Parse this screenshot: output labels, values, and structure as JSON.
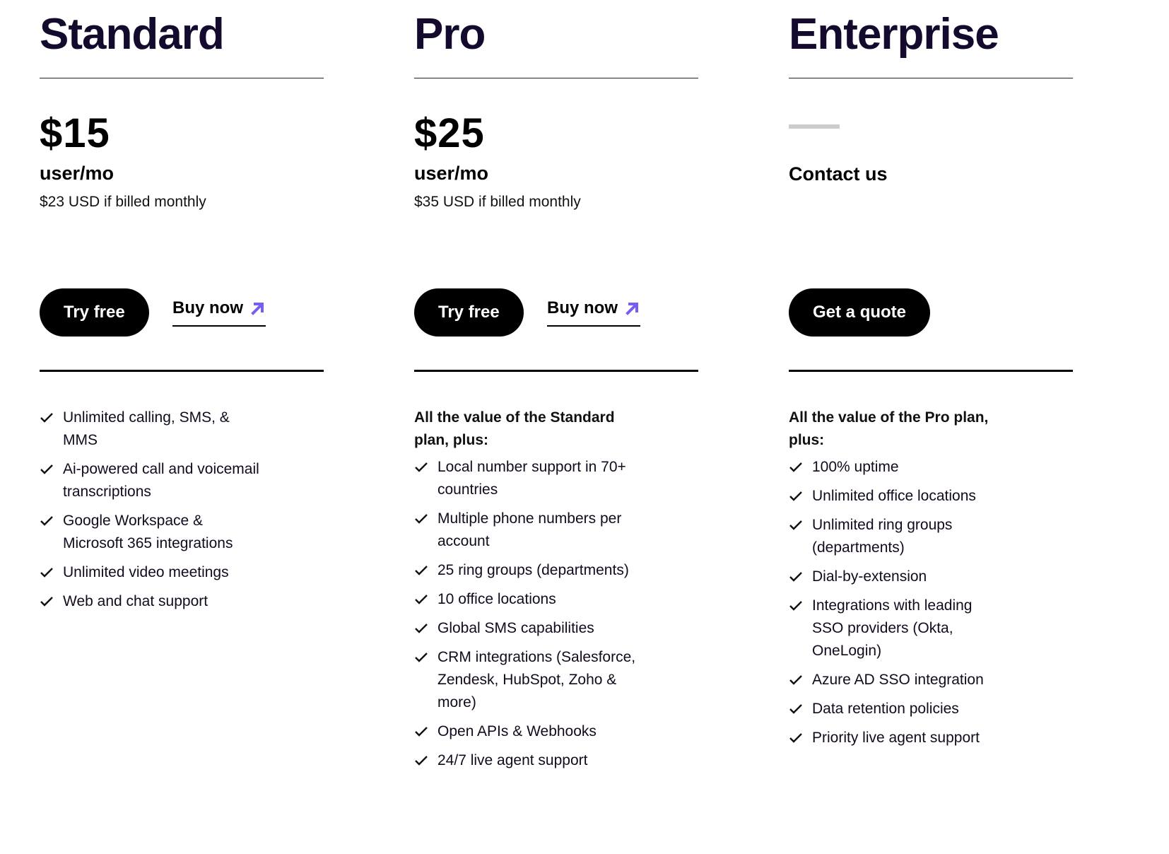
{
  "plans": [
    {
      "name": "Standard",
      "price": "$15",
      "per_unit": "user/mo",
      "monthly_note": "$23 USD if billed monthly",
      "primary_button": "Try free",
      "secondary_link": "Buy now",
      "secondary_icon": "arrow-up-right-icon",
      "features_intro": "",
      "features": [
        "Unlimited calling, SMS, & MMS",
        "Ai-powered call and voicemail transcriptions",
        "Google Workspace & Microsoft 365 integrations",
        "Unlimited video meetings",
        "Web and chat support"
      ]
    },
    {
      "name": "Pro",
      "price": "$25",
      "per_unit": "user/mo",
      "monthly_note": "$35 USD if billed monthly",
      "primary_button": "Try free",
      "secondary_link": "Buy now",
      "secondary_icon": "arrow-up-right-icon",
      "features_intro": "All the value of the Standard plan, plus:",
      "features": [
        "Local number support in 70+ countries",
        "Multiple phone numbers per account",
        "25 ring groups (departments)",
        "10 office locations",
        "Global SMS capabilities",
        "CRM integrations (Salesforce, Zendesk, HubSpot, Zoho & more)",
        "Open APIs & Webhooks",
        "24/7 live agent support"
      ]
    },
    {
      "name": "Enterprise",
      "contact": "Contact us",
      "primary_button": "Get a quote",
      "features_intro": "All the value of the Pro plan, plus:",
      "features": [
        "100% uptime",
        "Unlimited office locations",
        "Unlimited ring groups (departments)",
        "Dial-by-extension",
        "Integrations with leading SSO providers (Okta, OneLogin)",
        "Azure AD SSO integration",
        "Data retention policies",
        "Priority live agent support"
      ]
    }
  ],
  "colors": {
    "heading": "#140a2e",
    "button_bg": "#000000",
    "button_text": "#ffffff",
    "accent_arrow": "#7b5cf0",
    "placeholder_dash": "#cccccc"
  }
}
